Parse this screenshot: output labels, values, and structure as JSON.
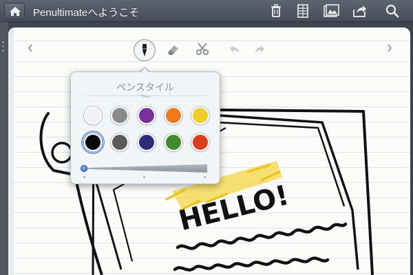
{
  "navbar": {
    "title": "Penultimateへようこそ",
    "icons": [
      "home-icon",
      "trash-icon",
      "pages-icon",
      "photo-icon",
      "share-icon",
      "search-icon"
    ]
  },
  "toolbar": {
    "tools": [
      "pen-icon",
      "eraser-icon",
      "scissors-icon",
      "undo-icon",
      "redo-icon"
    ],
    "nav": [
      "previous-page-icon",
      "next-page-icon"
    ]
  },
  "pen_style": {
    "title": "ペンスタイル",
    "colors": [
      "#f1f1f1",
      "#8a8a8a",
      "#7a2f9e",
      "#ee7a1c",
      "#f2cc2a",
      "#0a0a0a",
      "#5a5a5a",
      "#2e2a7c",
      "#3f8a2a",
      "#db3d1f"
    ],
    "selected_color": "#0a0a0a",
    "thickness_level": 0
  },
  "drawing": {
    "text": "HELLO!",
    "highlight_color": "#f2d128"
  }
}
